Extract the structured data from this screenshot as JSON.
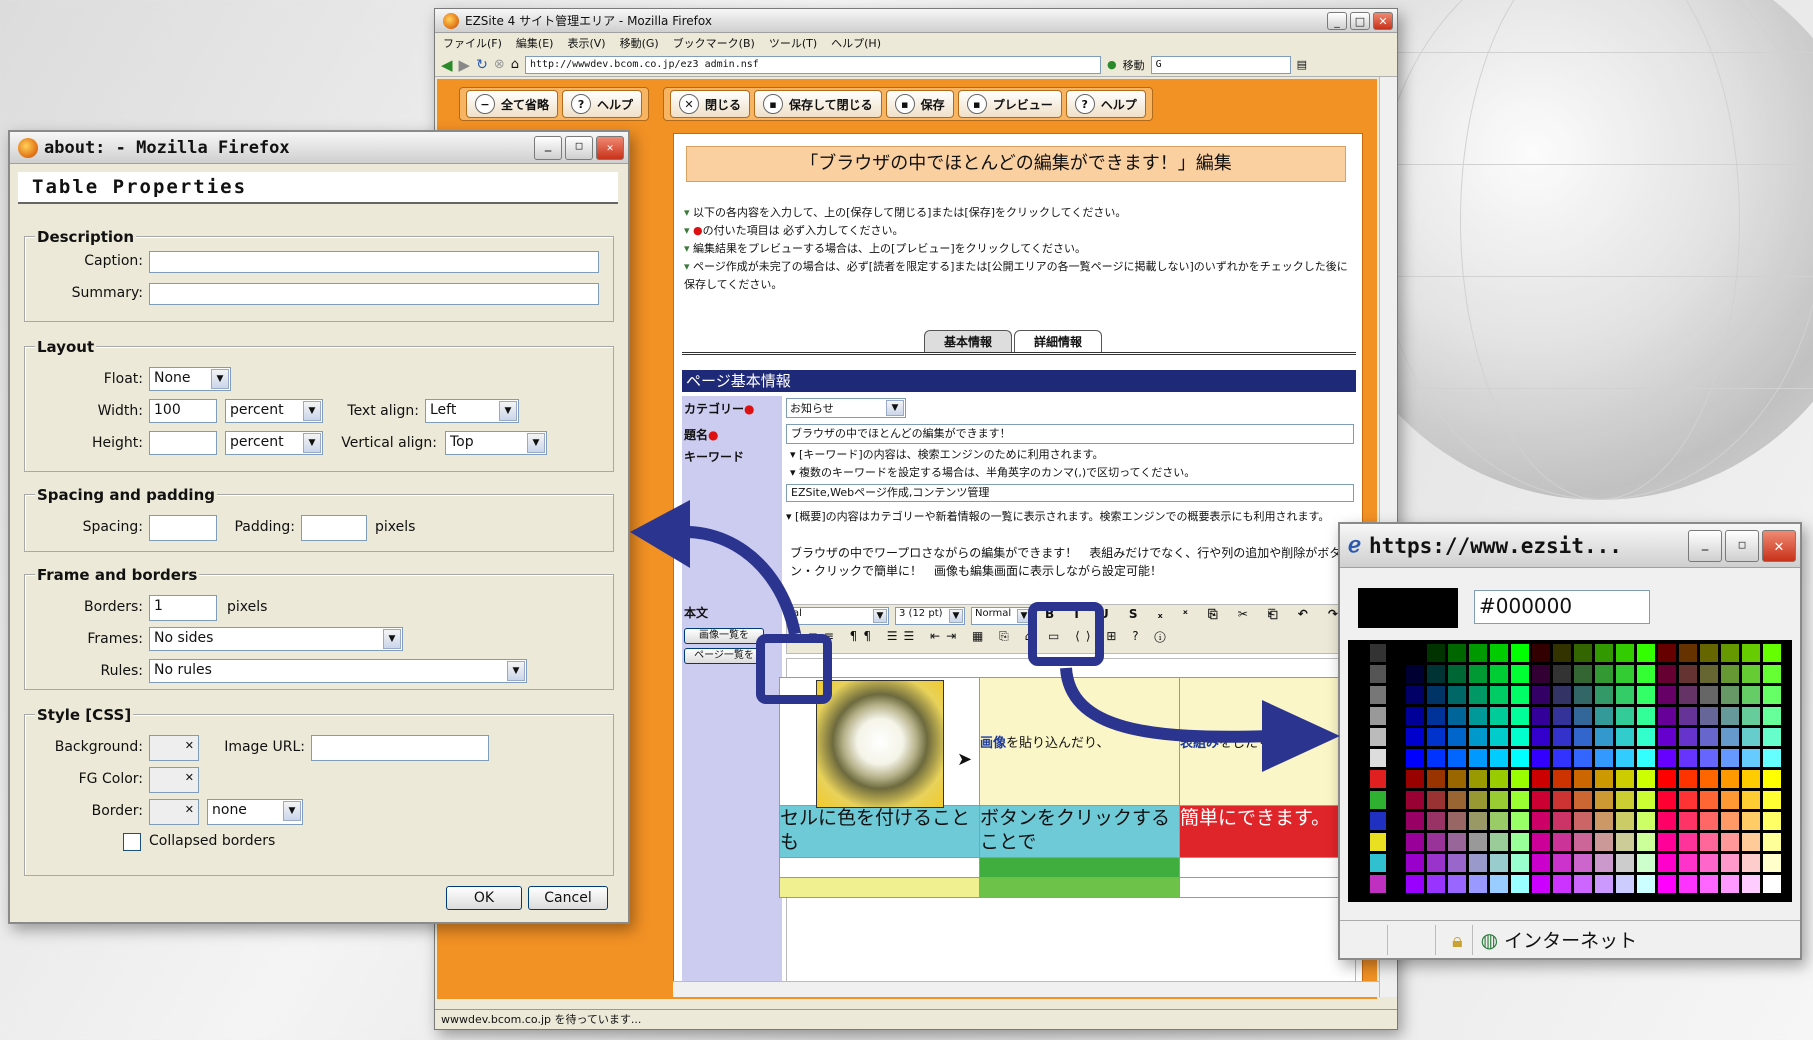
{
  "main_window": {
    "title": "EZSite 4 サイト管理エリア - Mozilla Firefox",
    "menu": [
      "ファイル(F)",
      "編集(E)",
      "表示(V)",
      "移動(G)",
      "ブックマーク(B)",
      "ツール(T)",
      "ヘルプ(H)"
    ],
    "url": "http://wwwdev.bcom.co.jp/ez3 admin.nsf",
    "go_label": "移動",
    "toolbar_left": [
      {
        "icon": "collapse-icon",
        "label": "全て省略"
      },
      {
        "icon": "help-icon",
        "label": "ヘルプ"
      }
    ],
    "toolbar_right": [
      {
        "icon": "close-icon",
        "label": "閉じる"
      },
      {
        "icon": "save-close-icon",
        "label": "保存して閉じる"
      },
      {
        "icon": "save-icon",
        "label": "保存"
      },
      {
        "icon": "preview-icon",
        "label": "プレビュー"
      },
      {
        "icon": "help-icon",
        "label": "ヘルプ"
      }
    ],
    "page_title": "「ブラウザの中でほとんどの編集ができます！」編集",
    "notes": [
      "以下の各内容を入力して、上の[保存して閉じる]または[保存]をクリックしてください。",
      "の付いた項目は 必ず入力してください。",
      "編集結果をプレビューする場合は、上の[プレビュー]をクリックしてください。",
      "ページ作成が未完了の場合は、必ず[読者を限定する]または[公開エリアの各一覧ページに掲載しない]のいずれかをチェックした後に保存してください。"
    ],
    "tabs": [
      "基本情報",
      "詳細情報"
    ],
    "section_header": "ページ基本情報",
    "fields": {
      "category_label": "カテゴリー",
      "category_value": "お知らせ",
      "title_label": "題名",
      "title_value": "ブラウザの中でほとんどの編集ができます！",
      "keyword_label": "キーワード",
      "keyword_notes": [
        "[キーワード]の内容は、検索エンジンのために利用されます。",
        "複数のキーワードを設定する場合は、半角英字のカンマ(,)で区切ってください。"
      ],
      "keyword_value": "EZSite,Webページ作成,コンテンツ管理",
      "summary_note": "[概要]の内容はカテゴリーや新着情報の一覧に表示されます。検索エンジンでの概要表示にも利用されます。",
      "summary_value": "ブラウザの中でワープロさながらの編集ができます！　表組みだけでなく、行や列の追加や削除がボタン・クリックで簡単に！　画像も編集画面に表示しながら設定可能！",
      "body_label": "本文",
      "image_list_btn": "画像一覧を",
      "page_list_btn": "ページ一覧を",
      "font_size": "3 (12 pt)",
      "format": "Normal"
    },
    "editor_table": {
      "r1c2_link": "画像",
      "r1c2_text": "を貼り込んだり、",
      "r1c3_link": "表組み",
      "r1c3_text": "をしたり、",
      "r2c1": "セルに色を付けることも",
      "r2c2": "ボタンをクリックすることで",
      "r2c3": "簡単にできます。"
    },
    "status": "wwwdev.bcom.co.jp を待っています..."
  },
  "table_dialog": {
    "window_title": "about: - Mozilla Firefox",
    "heading": "Table Properties",
    "description_legend": "Description",
    "caption_label": "Caption:",
    "caption_value": "",
    "summary_label": "Summary:",
    "summary_value": "",
    "layout_legend": "Layout",
    "float_label": "Float:",
    "float_value": "None",
    "width_label": "Width:",
    "width_value": "100",
    "width_unit": "percent",
    "height_label": "Height:",
    "height_value": "",
    "height_unit": "percent",
    "text_align_label": "Text align:",
    "text_align_value": "Left",
    "vertical_align_label": "Vertical align:",
    "vertical_align_value": "Top",
    "spacing_legend": "Spacing and padding",
    "spacing_label": "Spacing:",
    "padding_label": "Padding:",
    "pixels1": "pixels",
    "frame_legend": "Frame and borders",
    "borders_label": "Borders:",
    "borders_value": "1",
    "pixels2": "pixels",
    "frames_label": "Frames:",
    "frames_value": "No sides",
    "rules_label": "Rules:",
    "rules_value": "No rules",
    "style_legend": "Style [CSS]",
    "background_label": "Background:",
    "image_url_label": "Image URL:",
    "fg_label": "FG Color:",
    "border_label": "Border:",
    "border_style": "none",
    "collapsed_label": "Collapsed borders",
    "ok": "OK",
    "cancel": "Cancel"
  },
  "color_window": {
    "title": "https://www.ezsit...",
    "hex": "#000000",
    "status_zone": "インターネット"
  }
}
